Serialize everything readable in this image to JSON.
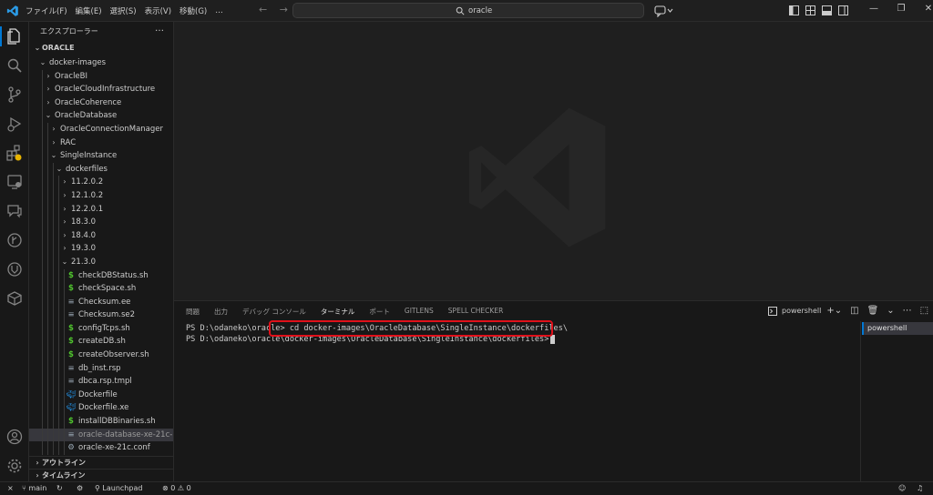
{
  "menu": [
    "ファイル(F)",
    "編集(E)",
    "選択(S)",
    "表示(V)",
    "移動(G)",
    "…"
  ],
  "search": {
    "text": "oracle"
  },
  "explorer": {
    "title": "エクスプローラー",
    "more": "…",
    "root": "ORACLE",
    "items": [
      {
        "label": "docker-images",
        "depth": 1,
        "type": "folder",
        "open": true
      },
      {
        "label": "OracleBI",
        "depth": 2,
        "type": "folder",
        "open": false
      },
      {
        "label": "OracleCloudInfrastructure",
        "depth": 2,
        "type": "folder",
        "open": false
      },
      {
        "label": "OracleCoherence",
        "depth": 2,
        "type": "folder",
        "open": false
      },
      {
        "label": "OracleDatabase",
        "depth": 2,
        "type": "folder",
        "open": true
      },
      {
        "label": "OracleConnectionManager",
        "depth": 3,
        "type": "folder",
        "open": false
      },
      {
        "label": "RAC",
        "depth": 3,
        "type": "folder",
        "open": false
      },
      {
        "label": "SingleInstance",
        "depth": 3,
        "type": "folder",
        "open": true
      },
      {
        "label": "dockerfiles",
        "depth": 4,
        "type": "folder",
        "open": true
      },
      {
        "label": "11.2.0.2",
        "depth": 5,
        "type": "folder",
        "open": false
      },
      {
        "label": "12.1.0.2",
        "depth": 5,
        "type": "folder",
        "open": false
      },
      {
        "label": "12.2.0.1",
        "depth": 5,
        "type": "folder",
        "open": false
      },
      {
        "label": "18.3.0",
        "depth": 5,
        "type": "folder",
        "open": false
      },
      {
        "label": "18.4.0",
        "depth": 5,
        "type": "folder",
        "open": false
      },
      {
        "label": "19.3.0",
        "depth": 5,
        "type": "folder",
        "open": false
      },
      {
        "label": "21.3.0",
        "depth": 5,
        "type": "folder",
        "open": true
      },
      {
        "label": "checkDBStatus.sh",
        "depth": 6,
        "type": "sh"
      },
      {
        "label": "checkSpace.sh",
        "depth": 6,
        "type": "sh"
      },
      {
        "label": "Checksum.ee",
        "depth": 6,
        "type": "text"
      },
      {
        "label": "Checksum.se2",
        "depth": 6,
        "type": "text"
      },
      {
        "label": "configTcps.sh",
        "depth": 6,
        "type": "sh"
      },
      {
        "label": "createDB.sh",
        "depth": 6,
        "type": "sh"
      },
      {
        "label": "createObserver.sh",
        "depth": 6,
        "type": "sh"
      },
      {
        "label": "db_inst.rsp",
        "depth": 6,
        "type": "text"
      },
      {
        "label": "dbca.rsp.tmpl",
        "depth": 6,
        "type": "text"
      },
      {
        "label": "Dockerfile",
        "depth": 6,
        "type": "docker"
      },
      {
        "label": "Dockerfile.xe",
        "depth": 6,
        "type": "docker"
      },
      {
        "label": "installDBBinaries.sh",
        "depth": 6,
        "type": "sh"
      },
      {
        "label": "oracle-database-xe-21c-1...",
        "depth": 6,
        "type": "text",
        "selected": true
      },
      {
        "label": "oracle-xe-21c.conf",
        "depth": 6,
        "type": "gear"
      }
    ],
    "outline": "アウトライン",
    "timeline": "タイムライン"
  },
  "panel": {
    "tabs": [
      "問題",
      "出力",
      "デバッグ コンソール",
      "ターミナル",
      "ポート",
      "GITLENS",
      "SPELL CHECKER"
    ],
    "active_tab": "ターミナル",
    "shell_label": "powershell",
    "terminal_lines": [
      "PS D:\\odaneko\\oracle> cd docker-images\\OracleDatabase\\SingleInstance\\dockerfiles\\",
      "PS D:\\odaneko\\oracle\\docker-images\\OracleDatabase\\SingleInstance\\dockerfiles>"
    ],
    "terminal_list": [
      "powershell"
    ]
  },
  "status": {
    "branch": "main",
    "launchpad": "Launchpad",
    "errors": "0",
    "warnings": "0"
  },
  "colors": {
    "accent": "#0078d4",
    "highlight": "#e0101a",
    "bg": "#1f1f1f"
  }
}
